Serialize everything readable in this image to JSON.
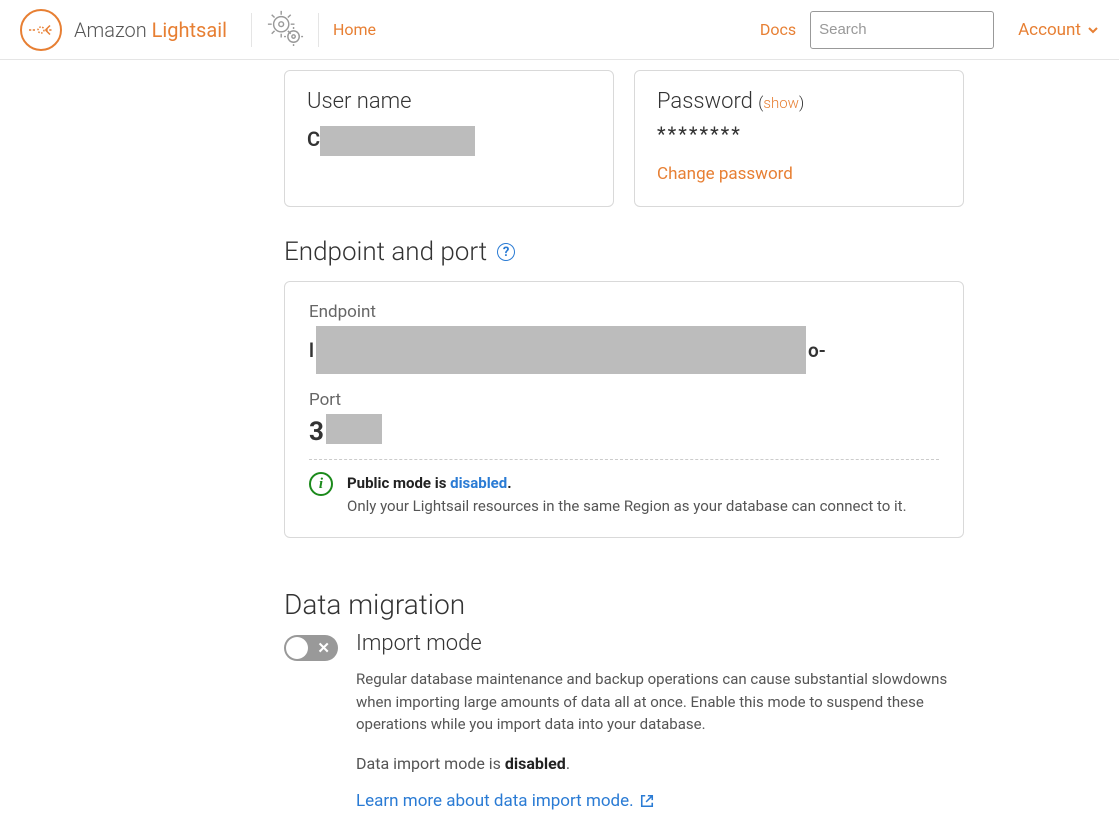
{
  "header": {
    "brand_prefix": "Amazon ",
    "brand_strong": "Lightsail",
    "home": "Home",
    "docs": "Docs",
    "search_placeholder": "Search",
    "account": "Account"
  },
  "credentials": {
    "username_label": "User name",
    "password_label": "Password",
    "show": "show",
    "password_value": "********",
    "change_password": "Change password"
  },
  "endpoint": {
    "title": "Endpoint and port",
    "help_glyph": "?",
    "endpoint_label": "Endpoint",
    "endpoint_lead": "l",
    "endpoint_trail": "o-",
    "port_label": "Port",
    "port_lead": "3",
    "info_prefix": "Public mode is ",
    "info_state": "disabled",
    "info_period": ".",
    "info_desc": "Only your Lightsail resources in the same Region as your database can connect to it."
  },
  "migration": {
    "section_title": "Data migration",
    "import_title": "Import mode",
    "desc": "Regular database maintenance and backup operations can cause substantial slowdowns when importing large amounts of data all at once. Enable this mode to suspend these operations while you import data into your database.",
    "status_prefix": "Data import mode is ",
    "status_value": "disabled",
    "status_suffix": ".",
    "learn_more": "Learn more about data import mode."
  }
}
